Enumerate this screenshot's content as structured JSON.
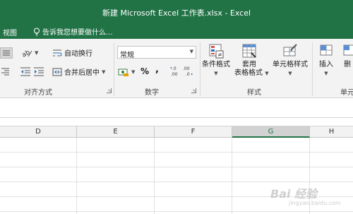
{
  "window": {
    "title": "新建 Microsoft Excel 工作表.xlsx - Excel"
  },
  "menu": {
    "view_tab": "视图",
    "tellme_placeholder": "告诉我您想要做什么..."
  },
  "ribbon": {
    "alignment": {
      "wrap_text": "自动换行",
      "merge_center": "合并后居中",
      "label": "对齐方式"
    },
    "number": {
      "format_value": "常规",
      "percent_symbol": "%",
      "comma_symbol": ",",
      "increase_decimal": "←.0 .00",
      "decrease_decimal": ".00 →.0",
      "label": "数字"
    },
    "styles": {
      "conditional_formatting": "条件格式",
      "format_as_table_line1": "套用",
      "format_as_table_line2": "表格格式",
      "cell_styles": "单元格样式",
      "label": "样式"
    },
    "cells": {
      "insert": "插入",
      "delete_partial": "删",
      "label_partial": "单元"
    }
  },
  "columns": [
    "D",
    "E",
    "F",
    "G",
    "H"
  ],
  "selected_column": "G",
  "watermark": {
    "text": "Bai 经验",
    "sub": "jingyan.baidu.com"
  },
  "colors": {
    "excel_green": "#217346",
    "ribbon_bg": "#f3f3f3",
    "selected_header": "#d2d2d2"
  }
}
